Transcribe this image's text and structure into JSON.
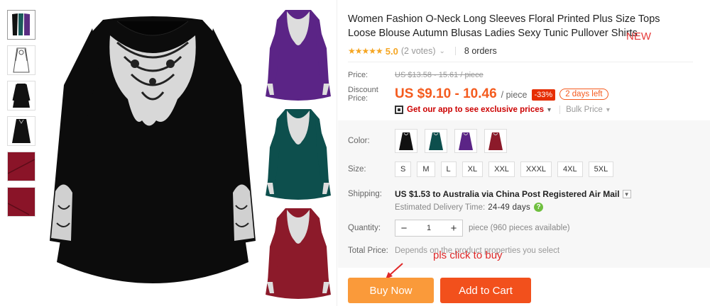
{
  "product": {
    "title": "Women Fashion O-Neck Long Sleeves Floral Printed Plus Size Tops Loose Blouse Autumn Blusas Ladies Sexy Tunic Pullover Shirts",
    "annotation_new": "NEW",
    "rating_value": "5.0",
    "votes": "(2 votes)",
    "orders": "8 orders",
    "stars": "★★★★★"
  },
  "price": {
    "label": "Price:",
    "old": "US $13.58 - 15.61 / piece",
    "discount_label": "Discount Price:",
    "current": "US $9.10 - 10.46",
    "unit": "/ piece",
    "off": "-33%",
    "days_left": "2 days left",
    "app_link": "Get our app to see exclusive prices",
    "bulk": "Bulk Price"
  },
  "sku": {
    "color_label": "Color:",
    "colors": [
      "black",
      "teal",
      "purple",
      "burgundy"
    ],
    "size_label": "Size:",
    "sizes": [
      "S",
      "M",
      "L",
      "XL",
      "XXL",
      "XXXL",
      "4XL",
      "5XL"
    ],
    "shipping_label": "Shipping:",
    "shipping": "US $1.53 to Australia via China Post Registered Air Mail",
    "est_label": "Estimated Delivery Time:",
    "est_value": "24-49 days",
    "quantity_label": "Quantity:",
    "quantity": "1",
    "qty_note": "piece (960 pieces available)",
    "total_label": "Total Price:",
    "total_note": "Depends on the product properties you select"
  },
  "annotation_click": "pls click to buy",
  "actions": {
    "buy_now": "Buy Now",
    "add_to_cart": "Add to Cart"
  },
  "colors": {
    "accent": "#f45b1e",
    "buy": "#fa9a3a",
    "cart": "#f2501c",
    "star": "#f5a623"
  }
}
